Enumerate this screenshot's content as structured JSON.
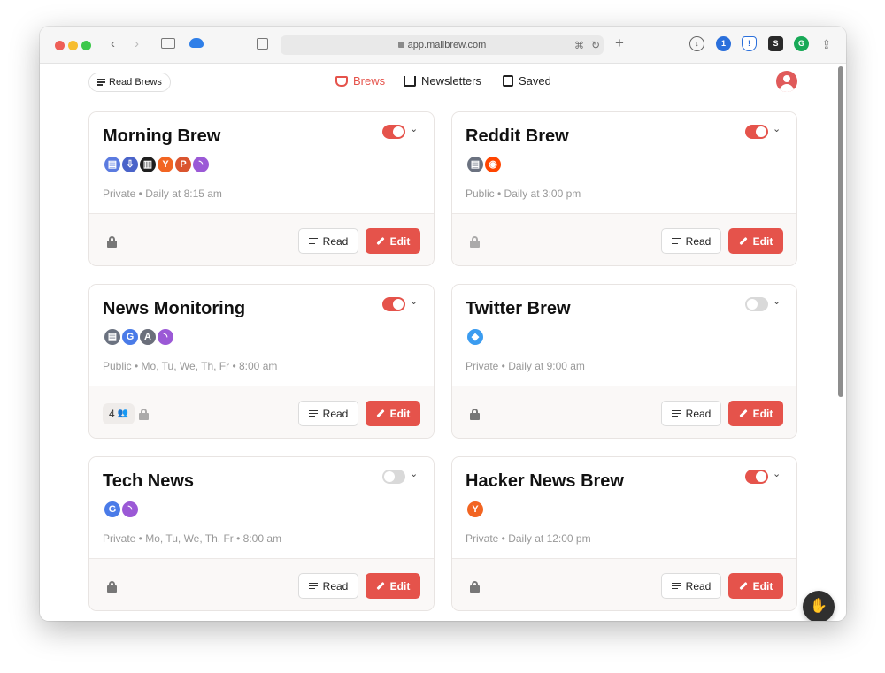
{
  "browser": {
    "url": "app.mailbrew.com"
  },
  "header": {
    "read_brews_label": "Read Brews",
    "nav": [
      {
        "label": "Brews",
        "active": true
      },
      {
        "label": "Newsletters",
        "active": false
      },
      {
        "label": "Saved",
        "active": false
      }
    ]
  },
  "brews": [
    {
      "title": "Morning Brew",
      "enabled": true,
      "visibility": "Private",
      "schedule": "Daily at 8:15 am",
      "sources": [
        "news-source-icon",
        "newsletter-icon",
        "rss-dark-icon",
        "hacker-news-icon",
        "product-hunt-icon",
        "rss-icon"
      ],
      "shared_count": null,
      "read_label": "Read",
      "edit_label": "Edit",
      "meta": "Private • Daily at 8:15 am"
    },
    {
      "title": "Reddit Brew",
      "enabled": true,
      "visibility": "Public",
      "schedule": "Daily at 3:00 pm",
      "sources": [
        "news-source-icon",
        "reddit-icon"
      ],
      "shared_count": null,
      "read_label": "Read",
      "edit_label": "Edit",
      "meta": "Public • Daily at 3:00 pm"
    },
    {
      "title": "News Monitoring",
      "enabled": true,
      "visibility": "Public",
      "schedule": "Mo, Tu, We, Th, Fr • 8:00 am",
      "sources": [
        "news-source-icon",
        "google-news-icon",
        "apple-news-icon",
        "rss-icon"
      ],
      "shared_count": "4",
      "read_label": "Read",
      "edit_label": "Edit",
      "meta": "Public • Mo, Tu, We, Th, Fr • 8:00 am"
    },
    {
      "title": "Twitter Brew",
      "enabled": false,
      "visibility": "Private",
      "schedule": "Daily at 9:00 am",
      "sources": [
        "twitter-list-icon"
      ],
      "shared_count": null,
      "read_label": "Read",
      "edit_label": "Edit",
      "meta": "Private • Daily at 9:00 am"
    },
    {
      "title": "Tech News",
      "enabled": false,
      "visibility": "Private",
      "schedule": "Mo, Tu, We, Th, Fr • 8:00 am",
      "sources": [
        "google-news-icon",
        "rss-icon"
      ],
      "shared_count": null,
      "read_label": "Read",
      "edit_label": "Edit",
      "meta": "Private • Mo, Tu, We, Th, Fr • 8:00 am"
    },
    {
      "title": "Hacker News Brew",
      "enabled": true,
      "visibility": "Private",
      "schedule": "Daily at 12:00 pm",
      "sources": [
        "hacker-news-icon"
      ],
      "shared_count": null,
      "read_label": "Read",
      "edit_label": "Edit",
      "meta": "Private • Daily at 12:00 pm"
    }
  ],
  "colors": {
    "accent": "#e5534b",
    "toggle_off": "#d9d9d9"
  }
}
